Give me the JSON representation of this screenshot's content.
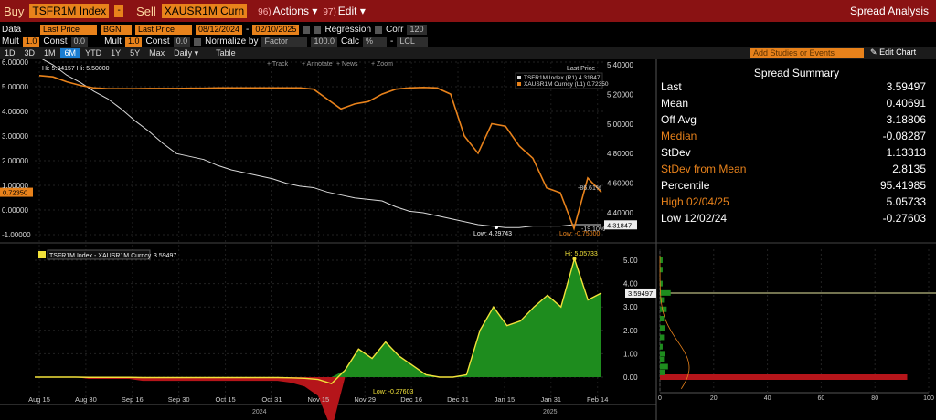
{
  "toolbar": {
    "buy_label": "Buy",
    "buy_security": "TSFR1M Index",
    "sell_label": "Sell",
    "sell_security": "XAUSR1M Curn",
    "actions_num": "96)",
    "actions_label": "Actions",
    "edit_num": "97)",
    "edit_label": "Edit",
    "title": "Spread Analysis"
  },
  "controls": {
    "data_label": "Data",
    "data_value1": "Last Price",
    "source": "BGN",
    "data_value2": "Last Price",
    "start_date": "08/12/2024",
    "end_date": "02/10/2025",
    "regression_label": "Regression",
    "corr_label": "Corr",
    "corr_value": "120",
    "mult_label": "Mult",
    "mult1": "1.0",
    "const_label": "Const",
    "const1": "0.0",
    "mult2": "1.0",
    "const2": "0.0",
    "normalize_label": "Normalize by",
    "normalize_value": "Factor",
    "factor_value": "100.0",
    "calc_label": "Calc",
    "calc_value": "%",
    "currency": "LCL"
  },
  "tabs": [
    "1D",
    "3D",
    "1M",
    "6M",
    "YTD",
    "1Y",
    "5Y",
    "Max"
  ],
  "active_tab": "6M",
  "frequency": "Daily",
  "table_label": "Table",
  "add_studies_placeholder": "Add Studies or Events",
  "edit_chart_label": "Edit Chart",
  "chart_tools": [
    "Track",
    "Annotate",
    "News",
    "Zoom"
  ],
  "summary": {
    "title": "Spread Summary",
    "rows": [
      {
        "k": "Last",
        "v": "3.59497"
      },
      {
        "k": "Mean",
        "v": "0.40691"
      },
      {
        "k": "Off Avg",
        "v": "3.18806"
      },
      {
        "k": "Median",
        "v": "-0.08287"
      },
      {
        "k": "StDev",
        "v": "1.13313"
      },
      {
        "k": "StDev from Mean",
        "v": "2.8135"
      },
      {
        "k": "Percentile",
        "v": "95.41985"
      },
      {
        "k": "High 02/04/25",
        "v": "5.05733"
      },
      {
        "k": "Low 12/02/24",
        "v": "-0.27603"
      }
    ]
  },
  "colors": {
    "orange": "#e8821b",
    "white_series": "#d9d9d9",
    "spread": "#f2e23a",
    "fill": "#1e8c1e",
    "neg": "#b5151a",
    "bar": "#8a1213"
  },
  "chart_data": [
    {
      "type": "line",
      "legend_title": "Last Price",
      "series": [
        {
          "name": "TSFR1M Index (R1)",
          "last": "4.31847",
          "axis": "right",
          "values": [
            5.45,
            5.4,
            5.33,
            5.28,
            5.22,
            5.17,
            5.1,
            5.02,
            4.95,
            4.87,
            4.8,
            4.78,
            4.76,
            4.72,
            4.69,
            4.67,
            4.65,
            4.63,
            4.6,
            4.58,
            4.57,
            4.54,
            4.52,
            4.5,
            4.49,
            4.48,
            4.44,
            4.41,
            4.4,
            4.38,
            4.36,
            4.34,
            4.32,
            4.31,
            4.3,
            4.3,
            4.31,
            4.31,
            4.31,
            4.32,
            4.32,
            4.32
          ]
        },
        {
          "name": "XAUSR1M Curncy (L1)",
          "last": "0.72350",
          "axis": "left",
          "values": [
            5.45,
            5.4,
            5.2,
            5.05,
            4.95,
            4.92,
            4.92,
            4.92,
            4.93,
            4.93,
            4.93,
            4.94,
            4.94,
            4.95,
            4.95,
            4.95,
            4.95,
            4.95,
            4.95,
            4.95,
            4.9,
            4.5,
            4.1,
            4.3,
            4.4,
            4.7,
            4.9,
            4.95,
            4.97,
            4.95,
            4.7,
            3.0,
            2.3,
            3.5,
            3.4,
            2.6,
            2.1,
            0.9,
            0.7,
            -0.75,
            1.3,
            0.72
          ]
        }
      ],
      "annotations": {
        "hi_left": "5.34157",
        "hi_right": "5.50000",
        "low_white": "4.29743",
        "low_orange": "-0.75000",
        "pct_orange": "-86.61%",
        "pct_white": "-19.10%"
      },
      "left_ticks": [
        "6.00000",
        "5.00000",
        "4.00000",
        "3.00000",
        "2.00000",
        "1.00000",
        "0.00000",
        "-1.00000"
      ],
      "right_ticks": [
        "5.40000",
        "5.20000",
        "5.00000",
        "4.80000",
        "4.60000",
        "4.40000"
      ],
      "left_axis_marker": "0.72350",
      "right_axis_marker": "4.31847"
    },
    {
      "type": "area",
      "legend": "TSFR1M Index - XAUSR1M Curncy",
      "last": "3.59497",
      "hi": "5.05733",
      "low": "-0.27603",
      "values": [
        0.0,
        0.0,
        0.0,
        0.0,
        -0.01,
        -0.01,
        -0.01,
        -0.01,
        -0.02,
        -0.02,
        -0.02,
        -0.02,
        -0.02,
        -0.02,
        -0.02,
        -0.02,
        -0.02,
        -0.02,
        -0.02,
        -0.03,
        -0.05,
        -0.1,
        -0.28,
        0.3,
        1.2,
        0.8,
        1.5,
        0.9,
        0.5,
        0.1,
        0.0,
        0.0,
        0.1,
        2.0,
        3.0,
        2.2,
        2.4,
        3.0,
        3.5,
        3.0,
        5.06,
        3.3,
        3.6
      ],
      "y_ticks": [
        "5.00",
        "4.00",
        "3.00",
        "2.00",
        "1.00",
        "0.00"
      ],
      "x_labels": [
        "Aug 15",
        "Aug 30",
        "Sep 16",
        "Sep 30",
        "Oct 15",
        "Oct 31",
        "Nov 15",
        "Nov 29",
        "Dec 16",
        "Dec 31",
        "Jan 15",
        "Jan 31",
        "Feb 14"
      ],
      "year_labels": [
        "2024",
        "2025"
      ],
      "hist_ticks": [
        "0",
        "20",
        "40",
        "60",
        "80",
        "100"
      ]
    }
  ]
}
